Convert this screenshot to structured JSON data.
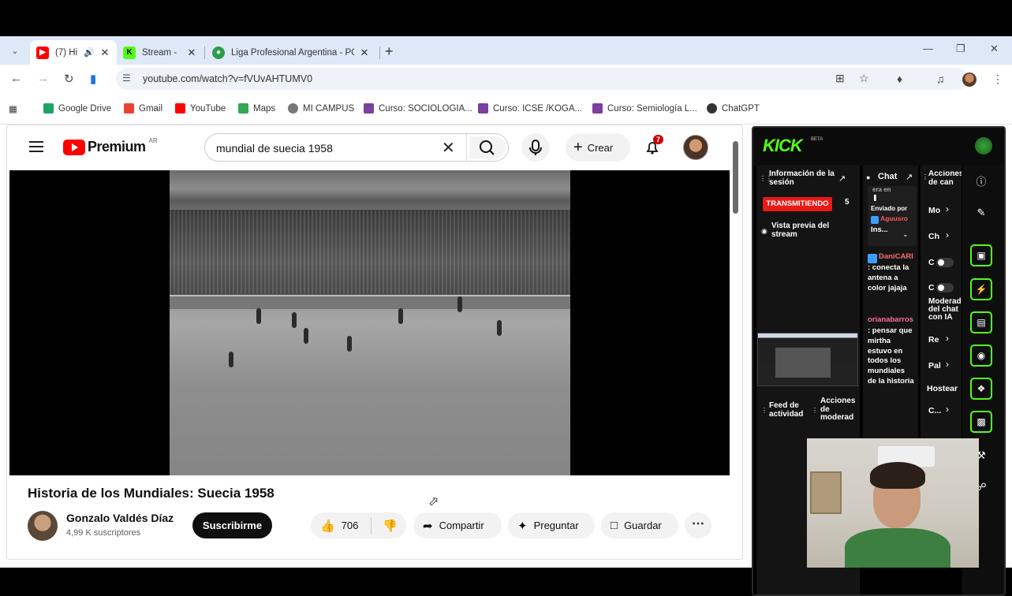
{
  "browser": {
    "tabs": [
      {
        "title": "(7) Hi",
        "favicon": "youtube-favicon",
        "audio": true
      },
      {
        "title": "Stream -",
        "favicon": "kick-favicon"
      },
      {
        "title": "Liga Profesional Argentina - PO",
        "favicon": "globe-favicon"
      }
    ],
    "url": "youtube.com/watch?v=fVUvAHTUMV0",
    "bookmarks": [
      {
        "label": "Google Drive",
        "color": "#1ea362"
      },
      {
        "label": "Gmail",
        "color": "#ea4335"
      },
      {
        "label": "YouTube",
        "color": "#ff0000"
      },
      {
        "label": "Maps",
        "color": "#34a853"
      },
      {
        "label": "MI CAMPUS",
        "color": "#777777"
      },
      {
        "label": "Curso: SOCIOLOGIA...",
        "color": "#7b3fa0"
      },
      {
        "label": "Curso: ICSE /KOGA...",
        "color": "#7b3fa0"
      },
      {
        "label": "Curso: Semiología L...",
        "color": "#7b3fa0"
      },
      {
        "label": "ChatGPT",
        "color": "#333333"
      }
    ]
  },
  "youtube": {
    "logo_text": "Premium",
    "country": "AR",
    "search_query": "mundial de suecia 1958",
    "create_label": "Crear",
    "notifications": "7",
    "video_title": "Historia de los Mundiales: Suecia 1958",
    "channel_name": "Gonzalo Valdés Díaz",
    "subscribers": "4,99 K suscriptores",
    "subscribe_label": "Suscribirme",
    "likes": "706",
    "share_label": "Compartir",
    "ask_label": "Preguntar",
    "save_label": "Guardar"
  },
  "kick": {
    "logo": "KICK",
    "beta": "BETA",
    "session_info": "Información de la sesión",
    "live_label": "TRANSMITIENDO",
    "viewers": "5",
    "preview_label": "Vista previa del stream",
    "activity_feed": "Feed de actividad",
    "mod_actions": "Acciones de moderad",
    "chat_label": "Chat",
    "pinned_prefix": "era en",
    "pinned_by": "Enviado por",
    "pinned_user": "Aguusro",
    "pinned_more": "Ins...",
    "messages": [
      {
        "user": "DaniCARI",
        "text": ": conecta la antena a color jajaja"
      },
      {
        "user": "orianabarros",
        "text": ": pensar que mirtha estuvo en todos los mundiales de la historia"
      }
    ],
    "actions_title": "Acciones de can",
    "actions": [
      "Mo",
      "Ch",
      "C",
      "C",
      "Moderad del chat con IA",
      "Re",
      "Pal",
      "Hostear",
      "C..."
    ],
    "accent": "#53fc18"
  }
}
